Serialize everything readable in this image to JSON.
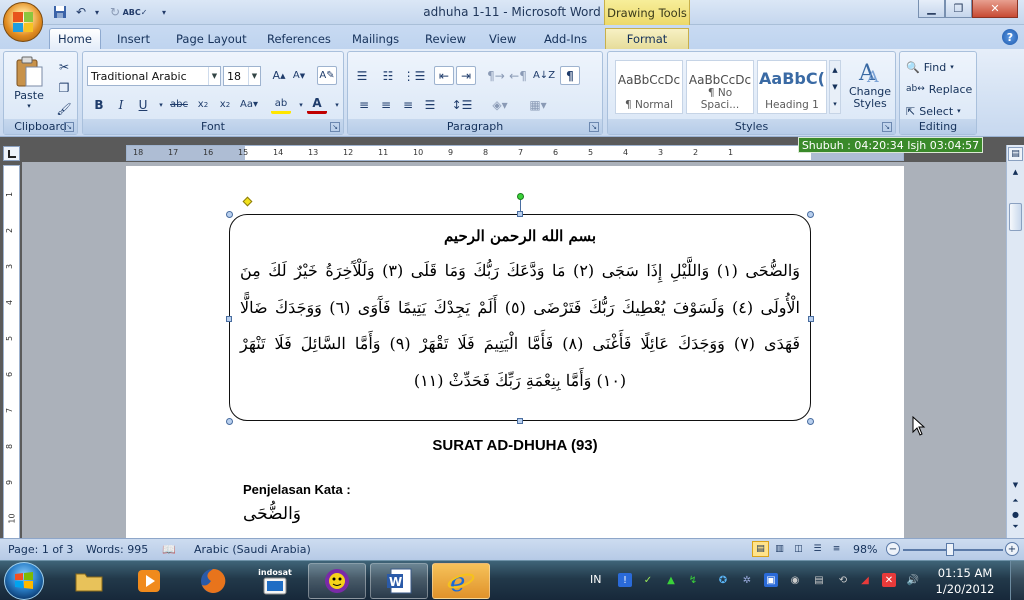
{
  "window": {
    "doc_title": "adhuha 1-11 - Microsoft Word",
    "contextual_title": "Drawing Tools"
  },
  "tabs": [
    {
      "label": "Home",
      "active": true
    },
    {
      "label": "Insert"
    },
    {
      "label": "Page Layout"
    },
    {
      "label": "References"
    },
    {
      "label": "Mailings"
    },
    {
      "label": "Review"
    },
    {
      "label": "View"
    },
    {
      "label": "Add-Ins"
    },
    {
      "label": "Format"
    }
  ],
  "ribbon": {
    "clipboard": {
      "paste_label": "Paste",
      "group_label": "Clipboard"
    },
    "font": {
      "family": "Traditional Arabic",
      "size": "18",
      "group_label": "Font"
    },
    "paragraph": {
      "group_label": "Paragraph"
    },
    "styles": {
      "cards": [
        {
          "sample": "AaBbCcDc",
          "name": "¶ Normal"
        },
        {
          "sample": "AaBbCcDc",
          "name": "¶ No Spaci..."
        },
        {
          "sample": "AaBbC(",
          "name": "Heading 1"
        }
      ],
      "change_styles_label": "Change Styles",
      "group_label": "Styles"
    },
    "editing": {
      "find_label": "Find",
      "replace_label": "Replace",
      "select_label": "Select",
      "group_label": "Editing"
    }
  },
  "timer_badge": "Shubuh : 04:20:34  Isjh 03:04:57",
  "ruler": {
    "h_ticks": [
      "18",
      "17",
      "16",
      "15",
      "14",
      "13",
      "12",
      "11",
      "10",
      "9",
      "8",
      "7",
      "6",
      "5",
      "4",
      "3",
      "2",
      "1"
    ],
    "v_ticks": [
      "1",
      "2",
      "3",
      "4",
      "5",
      "6",
      "7",
      "8",
      "9",
      "10"
    ]
  },
  "document": {
    "basmala": "بسم الله الرحمن الرحيم",
    "verse_lines": [
      "وَالضُّحَى (١) وَاللَّيْلِ إِذَا سَجَى (٢) مَا وَدَّعَكَ رَبُّكَ وَمَا قَلَى (٣) وَلَلْآَخِرَةُ خَيْرٌ لَكَ مِنَ",
      "الْأُولَى (٤) وَلَسَوْفَ يُعْطِيكَ رَبُّكَ فَتَرْضَى (٥) أَلَمْ يَجِدْكَ يَتِيمًا فَآَوَى (٦) وَوَجَدَكَ ضَالًّا",
      "فَهَدَى (٧) وَوَجَدَكَ عَائِلًا فَأَغْنَى (٨) فَأَمَّا الْيَتِيمَ فَلَا تَقْهَرْ (٩) وَأَمَّا السَّائِلَ فَلَا تَنْهَرْ",
      "(١٠) وَأَمَّا بِنِعْمَةِ رَبِّكَ فَحَدِّثْ (١١)"
    ],
    "caption": "SURAT AD-DHUHA (93)",
    "penjelasan_label": "Penjelasan Kata :",
    "first_word": "وَالضُّحَى"
  },
  "statusbar": {
    "page": "Page: 1 of 3",
    "words": "Words: 995",
    "language": "Arabic (Saudi Arabia)",
    "zoom": "98%"
  },
  "taskbar": {
    "indosat_label": "indosat",
    "ime": "IN",
    "time": "01:15 AM",
    "date": "1/20/2012"
  },
  "colors": {
    "timer_bg": "#3a8a2a",
    "ribbon_bg": "#dbe7f6",
    "taskbar_bg": "#22394a"
  }
}
